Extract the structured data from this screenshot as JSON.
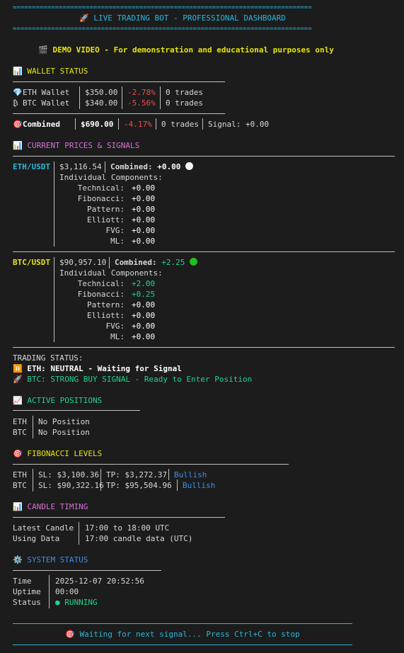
{
  "header": {
    "rule": "==============================================================================",
    "title": "🚀 LIVE TRADING BOT - PROFESSIONAL DASHBOARD",
    "demo": "🎬 DEMO VIDEO - For demonstration and educational purposes only"
  },
  "wallet": {
    "heading": "WALLET STATUS",
    "rows": [
      {
        "icon": "💎",
        "name": "ETH Wallet",
        "amount": "$350.00",
        "change": "-2.78%",
        "trades": "0 trades"
      },
      {
        "icon": "₿",
        "name": "BTC Wallet",
        "amount": "$340.00",
        "change": "-5.56%",
        "trades": "0 trades"
      }
    ],
    "combined": {
      "icon": "🎯",
      "name": "Combined",
      "amount": "$690.00",
      "change": "-4.17%",
      "trades": "0 trades",
      "signal": "Signal: +0.00"
    }
  },
  "prices": {
    "heading": "CURRENT PRICES & SIGNALS",
    "components_label": "Individual Components:",
    "combined_label": "Combined:",
    "assets": [
      {
        "pair": "ETH/USDT",
        "price": "$3,116.54",
        "combined": "+0.00",
        "dot": "#f2f2f2",
        "components": [
          {
            "name": "Technical:",
            "value": "+0.00",
            "pos": false
          },
          {
            "name": "Fibonacci:",
            "value": "+0.00",
            "pos": false
          },
          {
            "name": "Pattern:",
            "value": "+0.00",
            "pos": false
          },
          {
            "name": "Elliott:",
            "value": "+0.00",
            "pos": false
          },
          {
            "name": "FVG:",
            "value": "+0.00",
            "pos": false
          },
          {
            "name": "ML:",
            "value": "+0.00",
            "pos": false
          }
        ]
      },
      {
        "pair": "BTC/USDT",
        "price": "$90,957.10",
        "combined": "+2.25",
        "dot": "#1fbf1f",
        "components": [
          {
            "name": "Technical:",
            "value": "+2.00",
            "pos": true
          },
          {
            "name": "Fibonacci:",
            "value": "+0.25",
            "pos": true
          },
          {
            "name": "Pattern:",
            "value": "+0.00",
            "pos": false
          },
          {
            "name": "Elliott:",
            "value": "+0.00",
            "pos": false
          },
          {
            "name": "FVG:",
            "value": "+0.00",
            "pos": false
          },
          {
            "name": "ML:",
            "value": "+0.00",
            "pos": false
          }
        ]
      }
    ]
  },
  "trading_status": {
    "heading": "TRADING STATUS:",
    "eth": "⏸️ ETH: NEUTRAL - Waiting for Signal",
    "btc": "🚀 BTC: STRONG BUY SIGNAL - Ready to Enter Position"
  },
  "positions": {
    "heading": "ACTIVE POSITIONS",
    "rows": [
      {
        "asset": "ETH",
        "value": "No Position"
      },
      {
        "asset": "BTC",
        "value": "No Position"
      }
    ]
  },
  "fibonacci": {
    "heading": "FIBONACCI LEVELS",
    "rows": [
      {
        "asset": "ETH",
        "sl": "SL: $3,100.36",
        "tp": "TP: $3,272.37",
        "bias": "Bullish"
      },
      {
        "asset": "BTC",
        "sl": "SL: $90,322.16",
        "tp": "TP: $95,504.96",
        "bias": "Bullish"
      }
    ]
  },
  "candle": {
    "heading": "CANDLE TIMING",
    "rows": [
      {
        "label": "Latest Candle",
        "value": "17:00 to 18:00 UTC"
      },
      {
        "label": "Using Data",
        "value": "17:00 candle data (UTC)"
      }
    ]
  },
  "system": {
    "heading": "SYSTEM STATUS",
    "rows": [
      {
        "label": "Time",
        "value": "2025-12-07 20:52:56"
      },
      {
        "label": "Uptime",
        "value": "00:00"
      },
      {
        "label": "Status",
        "value": "● RUNNING"
      }
    ]
  },
  "footer": {
    "text": "🎯 Waiting for next signal... Press Ctrl+C to stop"
  },
  "icons": {
    "section": "bar-chart-icon",
    "fib": "target-icon",
    "positions": "trend-up-icon",
    "system": "gear-icon"
  },
  "colors": {
    "cyan": "#29b8db",
    "yellow": "#e5e510",
    "red": "#f14c4c",
    "green": "#23d18b",
    "blue": "#3b8eea",
    "magenta": "#d670d6",
    "bg": "#1c1c1c"
  }
}
